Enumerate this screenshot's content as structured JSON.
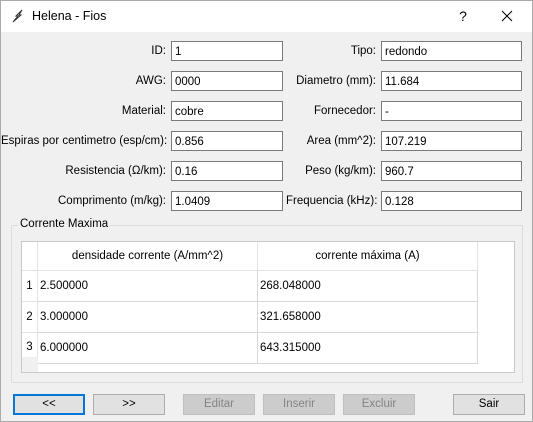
{
  "window": {
    "title": "Helena - Fios",
    "help_label": "?"
  },
  "form": {
    "left": [
      {
        "label": "ID:",
        "value": "1"
      },
      {
        "label": "AWG:",
        "value": "0000"
      },
      {
        "label": "Material:",
        "value": "cobre"
      },
      {
        "label": "Espiras por centimetro (esp/cm):",
        "value": "0.856"
      },
      {
        "label": "Resistencia (Ω/km):",
        "value": "0.16"
      },
      {
        "label": "Comprimento (m/kg):",
        "value": "1.0409"
      }
    ],
    "right": [
      {
        "label": "Tipo:",
        "value": "redondo"
      },
      {
        "label": "Diametro (mm):",
        "value": "11.684"
      },
      {
        "label": "Fornecedor:",
        "value": "-"
      },
      {
        "label": "Area (mm^2):",
        "value": "107.219"
      },
      {
        "label": "Peso (kg/km):",
        "value": "960.7"
      },
      {
        "label": "Frequencia (kHz):",
        "value": "0.128"
      }
    ]
  },
  "corrente": {
    "group_title": "Corrente Maxima",
    "columns": [
      "densidade corrente (A/mm^2)",
      "corrente máxima (A)"
    ],
    "rows": [
      {
        "index": "1",
        "densidade": "2.500000",
        "corrente": "268.048000"
      },
      {
        "index": "2",
        "densidade": "3.000000",
        "corrente": "321.658000"
      },
      {
        "index": "3",
        "densidade": "6.000000",
        "corrente": "643.315000"
      }
    ]
  },
  "buttons": {
    "first": "<<",
    "next": ">>",
    "edit": "Editar",
    "insert": "Inserir",
    "delete": "Excluir",
    "exit": "Sair"
  },
  "colors": {
    "window_bg": "#f0f0f0",
    "focus_border": "#0078d7",
    "disabled_text": "#838383"
  }
}
